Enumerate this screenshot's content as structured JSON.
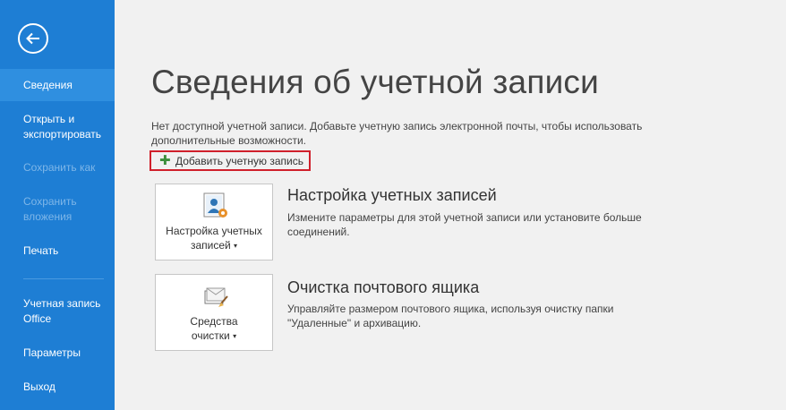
{
  "sidebar": {
    "items": [
      {
        "label": "Сведения"
      },
      {
        "label": "Открыть и экспортировать"
      },
      {
        "label": "Сохранить как"
      },
      {
        "label": "Сохранить вложения"
      },
      {
        "label": "Печать"
      },
      {
        "label": "Учетная запись Office"
      },
      {
        "label": "Параметры"
      },
      {
        "label": "Выход"
      }
    ]
  },
  "main": {
    "title": "Сведения об учетной записи",
    "info": "Нет доступной учетной записи. Добавьте учетную запись электронной почты, чтобы использовать дополнительные возможности.",
    "add_account_label": "Добавить учетную запись",
    "sections": [
      {
        "tile_line1": "Настройка учетных",
        "tile_line2": "записей",
        "title": "Настройка учетных записей",
        "desc": "Измените параметры для этой учетной записи или установите больше соединений."
      },
      {
        "tile_line1": "Средства",
        "tile_line2": "очистки",
        "title": "Очистка почтового ящика",
        "desc": "Управляйте размером почтового ящика, используя очистку папки \"Удаленные\" и архивацию."
      }
    ]
  }
}
